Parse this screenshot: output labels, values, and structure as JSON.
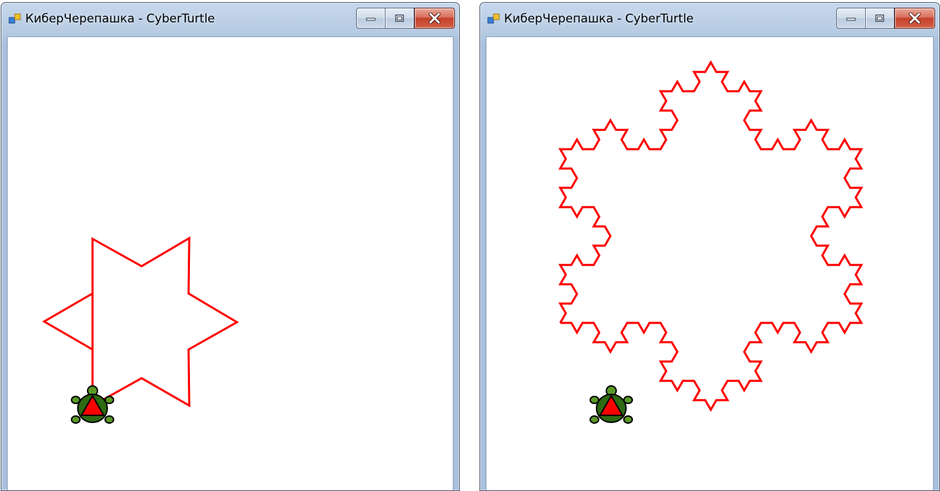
{
  "windows": [
    {
      "title": "КиберЧерепашка - CyberTurtle",
      "drawing": "six-pointed star",
      "pen_color": "#ff0000",
      "caption_buttons": [
        "minimize",
        "maximize",
        "close"
      ]
    },
    {
      "title": "КиберЧерепашка - CyberTurtle",
      "drawing": "koch snowflake",
      "pen_color": "#ff0000",
      "caption_buttons": [
        "minimize",
        "maximize",
        "close"
      ]
    }
  ],
  "colors": {
    "pen": "#ff0000",
    "turtle_shell": "#2e6b12",
    "turtle_body": "#5a9a25",
    "turtle_marker": "#ff0000",
    "close_button": "#c4412b",
    "titlebar": "#b7cbe3"
  },
  "icons": [
    "app-icon",
    "minimize-icon",
    "maximize-icon",
    "close-icon",
    "turtle-icon"
  ]
}
